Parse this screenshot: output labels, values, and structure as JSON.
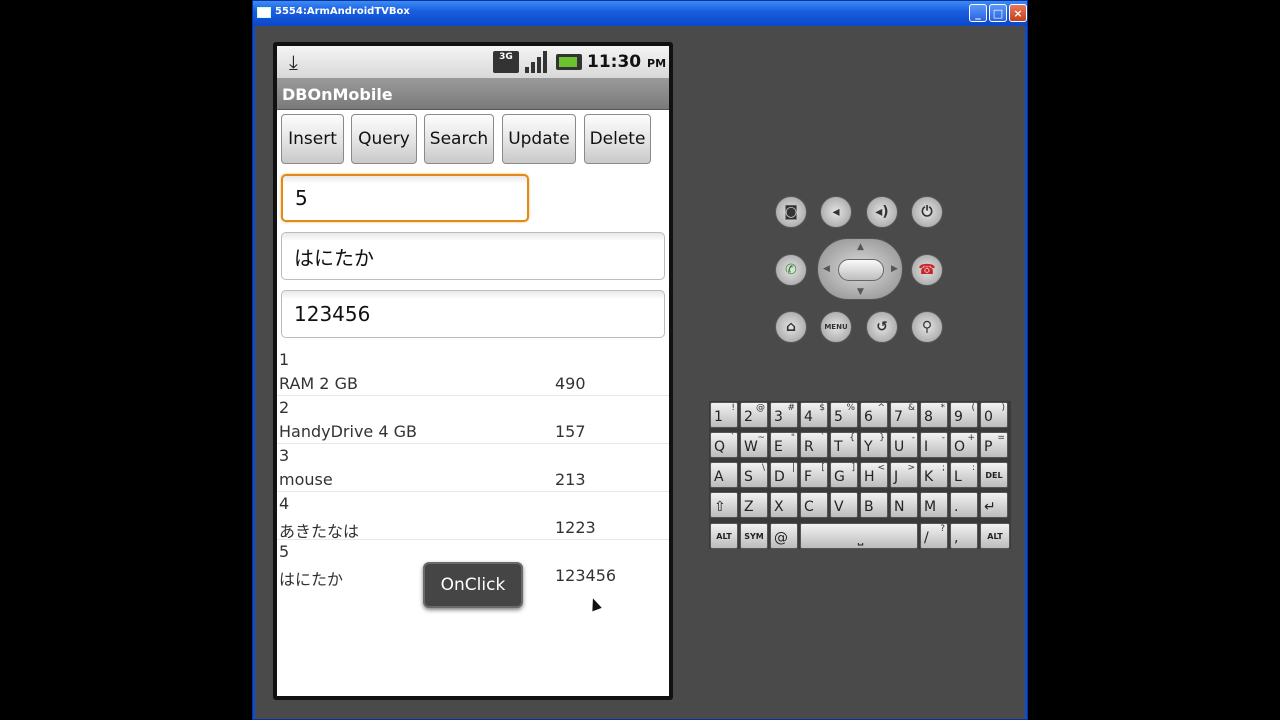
{
  "window": {
    "title": "5554:ArmAndroidTVBox",
    "minimize": "_",
    "maximize": "□",
    "close": "×"
  },
  "status_bar": {
    "network": "3G",
    "time": "11:30",
    "ampm": "PM"
  },
  "app": {
    "title": "DBOnMobile"
  },
  "buttons": {
    "insert": "Insert",
    "query": "Query",
    "search": "Search",
    "update": "Update",
    "delete": "Delete"
  },
  "fields": {
    "id_value": "5",
    "name_value": "はにたか",
    "price_value": "123456"
  },
  "rows": [
    {
      "id": "1",
      "name": "RAM 2 GB",
      "price": "490"
    },
    {
      "id": "2",
      "name": "HandyDrive 4 GB",
      "price": "157"
    },
    {
      "id": "3",
      "name": "mouse",
      "price": "213"
    },
    {
      "id": "4",
      "name": "あきたなは",
      "price": "1223"
    },
    {
      "id": "5",
      "name": "はにたか",
      "price": "123456"
    }
  ],
  "toast": {
    "text": "OnClick"
  },
  "hardware": {
    "menu_label": "MENU"
  },
  "keyboard": {
    "row1": [
      {
        "k": "1",
        "s": "!"
      },
      {
        "k": "2",
        "s": "@"
      },
      {
        "k": "3",
        "s": "#"
      },
      {
        "k": "4",
        "s": "$"
      },
      {
        "k": "5",
        "s": "%"
      },
      {
        "k": "6",
        "s": "^"
      },
      {
        "k": "7",
        "s": "&"
      },
      {
        "k": "8",
        "s": "*"
      },
      {
        "k": "9",
        "s": "("
      },
      {
        "k": "0",
        "s": ")"
      }
    ],
    "row2": [
      {
        "k": "Q",
        "s": "`"
      },
      {
        "k": "W",
        "s": "~"
      },
      {
        "k": "E",
        "s": "\""
      },
      {
        "k": "R",
        "s": "`"
      },
      {
        "k": "T",
        "s": "{"
      },
      {
        "k": "Y",
        "s": "}"
      },
      {
        "k": "U",
        "s": "-"
      },
      {
        "k": "I",
        "s": "-"
      },
      {
        "k": "O",
        "s": "+"
      },
      {
        "k": "P",
        "s": "="
      }
    ],
    "row3": [
      {
        "k": "A",
        "s": ""
      },
      {
        "k": "S",
        "s": "\\"
      },
      {
        "k": "D",
        "s": "|"
      },
      {
        "k": "F",
        "s": "["
      },
      {
        "k": "G",
        "s": "]"
      },
      {
        "k": "H",
        "s": "<"
      },
      {
        "k": "J",
        "s": ">"
      },
      {
        "k": "K",
        "s": ";"
      },
      {
        "k": "L",
        "s": ":"
      },
      {
        "k": "DEL",
        "s": ""
      }
    ],
    "row4": [
      {
        "k": "⇧",
        "s": ""
      },
      {
        "k": "Z",
        "s": ""
      },
      {
        "k": "X",
        "s": ""
      },
      {
        "k": "C",
        "s": ""
      },
      {
        "k": "V",
        "s": ""
      },
      {
        "k": "B",
        "s": ""
      },
      {
        "k": "N",
        "s": ""
      },
      {
        "k": "M",
        "s": ""
      },
      {
        "k": ".",
        "s": ""
      },
      {
        "k": "↵",
        "s": ""
      }
    ],
    "row5": {
      "alt_left": "ALT",
      "sym": "SYM",
      "at": "@",
      "space": "⎵",
      "slash": "/",
      "slash_sup": "?",
      "comma": ",",
      "alt_right": "ALT"
    }
  }
}
